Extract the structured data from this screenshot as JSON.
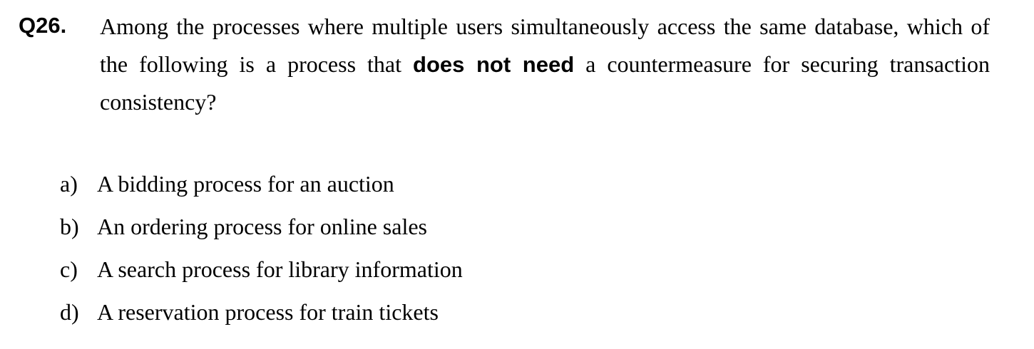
{
  "question": {
    "number": "Q26.",
    "text_before": "Among the processes where multiple users simultaneously access the same database, which of the following is a process that ",
    "text_emphasis": "does not need",
    "text_after": " a countermeasure for securing transaction consistency?"
  },
  "choices": [
    {
      "letter": "a)",
      "text": "A bidding process for an auction"
    },
    {
      "letter": "b)",
      "text": "An ordering process for online sales"
    },
    {
      "letter": "c)",
      "text": "A search process for library information"
    },
    {
      "letter": "d)",
      "text": "A reservation process for train tickets"
    }
  ]
}
